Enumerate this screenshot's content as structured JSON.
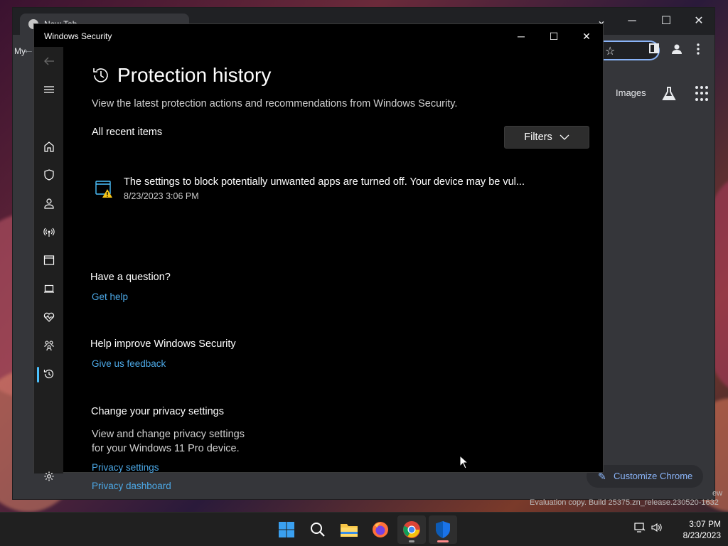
{
  "chrome": {
    "tab_title": "New Tab",
    "bookmark_text": "My",
    "images_link": "Images",
    "customize_label": "Customize Chrome",
    "controls": {
      "minimize": "─",
      "maximize": "☐",
      "close": "✕",
      "tabsearch": "⌄"
    }
  },
  "ws": {
    "window_title": "Windows Security",
    "page_title": "Protection history",
    "subtitle": "View the latest protection actions and recommendations from Windows Security.",
    "all_recent": "All recent items",
    "filters_label": "Filters",
    "items": [
      {
        "text": "The settings to block potentially unwanted apps are turned off. Your device may be vul...",
        "date": "8/23/2023 3:06 PM"
      }
    ],
    "question": {
      "heading": "Have a question?",
      "link": "Get help"
    },
    "improve": {
      "heading": "Help improve Windows Security",
      "link": "Give us feedback"
    },
    "privacy": {
      "heading": "Change your privacy settings",
      "line1": "View and change privacy settings",
      "line2": "for your Windows 11 Pro device.",
      "link1": "Privacy settings",
      "link2": "Privacy dashboard"
    }
  },
  "watermark": "Evaluation copy. Build 25375.zn_release.230520-1632",
  "watermark_tail": "ew",
  "taskbar": {
    "time": "3:07 PM",
    "date": "8/23/2023"
  },
  "colors": {
    "link": "#4ca8e6",
    "accent": "#4cc2ff",
    "warning": "#f5c518"
  }
}
